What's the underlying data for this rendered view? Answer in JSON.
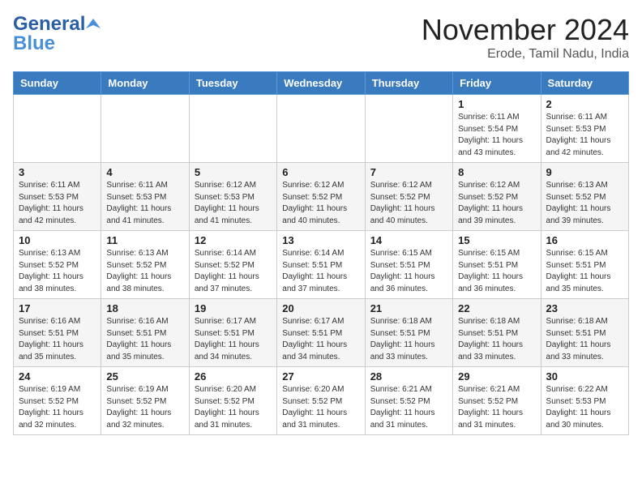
{
  "logo": {
    "general": "General",
    "blue": "Blue"
  },
  "title": "November 2024",
  "location": "Erode, Tamil Nadu, India",
  "days_of_week": [
    "Sunday",
    "Monday",
    "Tuesday",
    "Wednesday",
    "Thursday",
    "Friday",
    "Saturday"
  ],
  "weeks": [
    [
      {
        "day": "",
        "info": ""
      },
      {
        "day": "",
        "info": ""
      },
      {
        "day": "",
        "info": ""
      },
      {
        "day": "",
        "info": ""
      },
      {
        "day": "",
        "info": ""
      },
      {
        "day": "1",
        "info": "Sunrise: 6:11 AM\nSunset: 5:54 PM\nDaylight: 11 hours\nand 43 minutes."
      },
      {
        "day": "2",
        "info": "Sunrise: 6:11 AM\nSunset: 5:53 PM\nDaylight: 11 hours\nand 42 minutes."
      }
    ],
    [
      {
        "day": "3",
        "info": "Sunrise: 6:11 AM\nSunset: 5:53 PM\nDaylight: 11 hours\nand 42 minutes."
      },
      {
        "day": "4",
        "info": "Sunrise: 6:11 AM\nSunset: 5:53 PM\nDaylight: 11 hours\nand 41 minutes."
      },
      {
        "day": "5",
        "info": "Sunrise: 6:12 AM\nSunset: 5:53 PM\nDaylight: 11 hours\nand 41 minutes."
      },
      {
        "day": "6",
        "info": "Sunrise: 6:12 AM\nSunset: 5:52 PM\nDaylight: 11 hours\nand 40 minutes."
      },
      {
        "day": "7",
        "info": "Sunrise: 6:12 AM\nSunset: 5:52 PM\nDaylight: 11 hours\nand 40 minutes."
      },
      {
        "day": "8",
        "info": "Sunrise: 6:12 AM\nSunset: 5:52 PM\nDaylight: 11 hours\nand 39 minutes."
      },
      {
        "day": "9",
        "info": "Sunrise: 6:13 AM\nSunset: 5:52 PM\nDaylight: 11 hours\nand 39 minutes."
      }
    ],
    [
      {
        "day": "10",
        "info": "Sunrise: 6:13 AM\nSunset: 5:52 PM\nDaylight: 11 hours\nand 38 minutes."
      },
      {
        "day": "11",
        "info": "Sunrise: 6:13 AM\nSunset: 5:52 PM\nDaylight: 11 hours\nand 38 minutes."
      },
      {
        "day": "12",
        "info": "Sunrise: 6:14 AM\nSunset: 5:52 PM\nDaylight: 11 hours\nand 37 minutes."
      },
      {
        "day": "13",
        "info": "Sunrise: 6:14 AM\nSunset: 5:51 PM\nDaylight: 11 hours\nand 37 minutes."
      },
      {
        "day": "14",
        "info": "Sunrise: 6:15 AM\nSunset: 5:51 PM\nDaylight: 11 hours\nand 36 minutes."
      },
      {
        "day": "15",
        "info": "Sunrise: 6:15 AM\nSunset: 5:51 PM\nDaylight: 11 hours\nand 36 minutes."
      },
      {
        "day": "16",
        "info": "Sunrise: 6:15 AM\nSunset: 5:51 PM\nDaylight: 11 hours\nand 35 minutes."
      }
    ],
    [
      {
        "day": "17",
        "info": "Sunrise: 6:16 AM\nSunset: 5:51 PM\nDaylight: 11 hours\nand 35 minutes."
      },
      {
        "day": "18",
        "info": "Sunrise: 6:16 AM\nSunset: 5:51 PM\nDaylight: 11 hours\nand 35 minutes."
      },
      {
        "day": "19",
        "info": "Sunrise: 6:17 AM\nSunset: 5:51 PM\nDaylight: 11 hours\nand 34 minutes."
      },
      {
        "day": "20",
        "info": "Sunrise: 6:17 AM\nSunset: 5:51 PM\nDaylight: 11 hours\nand 34 minutes."
      },
      {
        "day": "21",
        "info": "Sunrise: 6:18 AM\nSunset: 5:51 PM\nDaylight: 11 hours\nand 33 minutes."
      },
      {
        "day": "22",
        "info": "Sunrise: 6:18 AM\nSunset: 5:51 PM\nDaylight: 11 hours\nand 33 minutes."
      },
      {
        "day": "23",
        "info": "Sunrise: 6:18 AM\nSunset: 5:51 PM\nDaylight: 11 hours\nand 33 minutes."
      }
    ],
    [
      {
        "day": "24",
        "info": "Sunrise: 6:19 AM\nSunset: 5:52 PM\nDaylight: 11 hours\nand 32 minutes."
      },
      {
        "day": "25",
        "info": "Sunrise: 6:19 AM\nSunset: 5:52 PM\nDaylight: 11 hours\nand 32 minutes."
      },
      {
        "day": "26",
        "info": "Sunrise: 6:20 AM\nSunset: 5:52 PM\nDaylight: 11 hours\nand 31 minutes."
      },
      {
        "day": "27",
        "info": "Sunrise: 6:20 AM\nSunset: 5:52 PM\nDaylight: 11 hours\nand 31 minutes."
      },
      {
        "day": "28",
        "info": "Sunrise: 6:21 AM\nSunset: 5:52 PM\nDaylight: 11 hours\nand 31 minutes."
      },
      {
        "day": "29",
        "info": "Sunrise: 6:21 AM\nSunset: 5:52 PM\nDaylight: 11 hours\nand 31 minutes."
      },
      {
        "day": "30",
        "info": "Sunrise: 6:22 AM\nSunset: 5:53 PM\nDaylight: 11 hours\nand 30 minutes."
      }
    ]
  ]
}
